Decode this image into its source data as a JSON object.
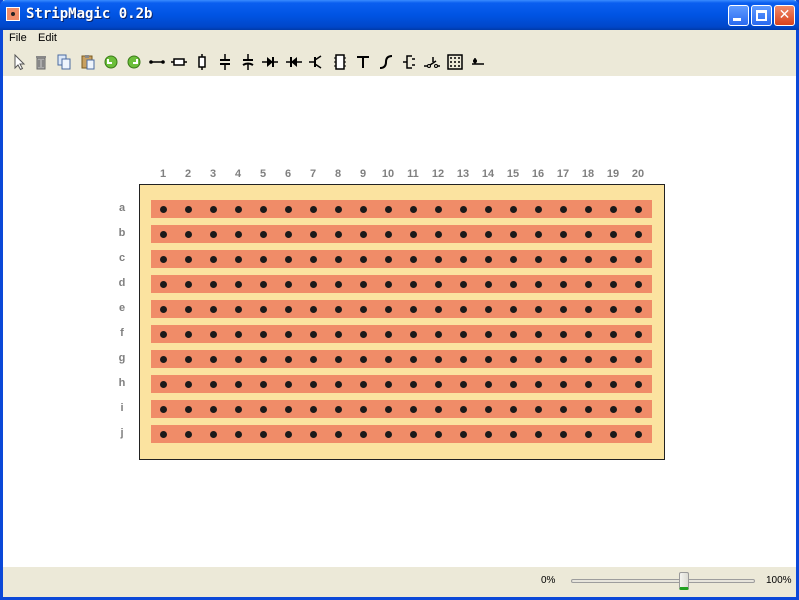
{
  "window": {
    "title": "StripMagic 0.2b"
  },
  "menu": {
    "items": [
      "File",
      "Edit"
    ]
  },
  "toolbar": {
    "tools": [
      "select-icon",
      "delete-icon",
      "copy-icon",
      "paste-icon",
      "undo-icon",
      "redo-icon",
      "wire-link-icon",
      "resistor-icon",
      "vertical-resistor-icon",
      "capacitor-icon",
      "polarized-capacitor-icon",
      "diode-icon",
      "diode-reverse-icon",
      "transistor-icon",
      "ic-socket-icon",
      "track-cut-icon",
      "flying-wire-icon",
      "connector-icon",
      "switch-icon",
      "grid-icon",
      "pin-icon"
    ]
  },
  "board": {
    "columns": [
      "1",
      "2",
      "3",
      "4",
      "5",
      "6",
      "7",
      "8",
      "9",
      "10",
      "11",
      "12",
      "13",
      "14",
      "15",
      "16",
      "17",
      "18",
      "19",
      "20"
    ],
    "rows": [
      "a",
      "b",
      "c",
      "d",
      "e",
      "f",
      "g",
      "h",
      "i",
      "j"
    ],
    "colors": {
      "board": "#fbe3a0",
      "strip": "#f08c68",
      "hole": "#1a1a1a",
      "label": "#808080"
    }
  },
  "status": {
    "zoom_min_label": "0%",
    "zoom_max_label": "100%",
    "zoom_fraction": 0.62
  }
}
